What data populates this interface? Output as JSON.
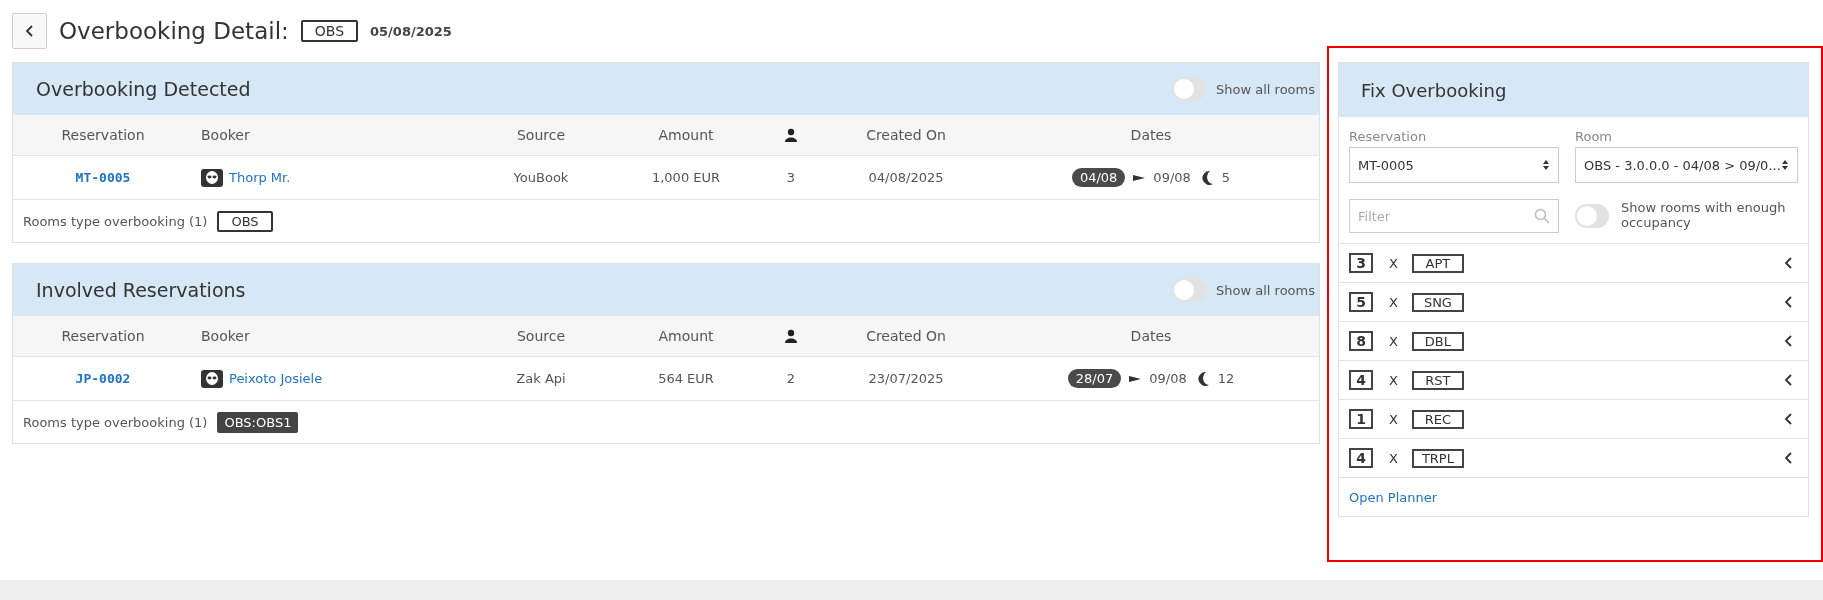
{
  "header": {
    "title": "Overbooking Detail:",
    "room_type": "OBS",
    "date": "05/08/2025"
  },
  "sections": [
    {
      "title": "Overbooking Detected",
      "toggle": {
        "label": "Show all rooms",
        "on": false
      },
      "columns": [
        {
          "kind": "text",
          "label": "Reservation"
        },
        {
          "kind": "text",
          "label": "Booker"
        },
        {
          "kind": "text",
          "label": "Source"
        },
        {
          "kind": "text",
          "label": "Amount"
        },
        {
          "kind": "guests"
        },
        {
          "kind": "text",
          "label": "Created On"
        },
        {
          "kind": "text",
          "label": "Dates"
        }
      ],
      "rows": [
        {
          "reservation": "MT-0005",
          "booker": "Thorp Mr.",
          "source": "YouBook",
          "amount": "1,000 EUR",
          "guests": "3",
          "created_on": "04/08/2025",
          "arrival": "04/08",
          "departure": "09/08",
          "nights": "5"
        }
      ],
      "footer": {
        "label": "Rooms type overbooking (1)",
        "room_types": [
          {
            "label": "OBS",
            "kind": "outline"
          }
        ]
      }
    },
    {
      "title": "Involved Reservations",
      "toggle": {
        "label": "Show all rooms",
        "on": false
      },
      "columns": [
        {
          "kind": "text",
          "label": "Reservation"
        },
        {
          "kind": "text",
          "label": "Booker"
        },
        {
          "kind": "text",
          "label": "Source"
        },
        {
          "kind": "text",
          "label": "Amount"
        },
        {
          "kind": "guests"
        },
        {
          "kind": "text",
          "label": "Created On"
        },
        {
          "kind": "text",
          "label": "Dates"
        }
      ],
      "rows": [
        {
          "reservation": "JP-0002",
          "booker": "Peixoto Josiele",
          "source": "Zak Api",
          "amount": "564 EUR",
          "guests": "2",
          "created_on": "23/07/2025",
          "arrival": "28/07",
          "departure": "09/08",
          "nights": "12"
        }
      ],
      "footer": {
        "label": "Rooms type overbooking (1)",
        "room_types": [
          {
            "label": "OBS:OBS1",
            "kind": "filled"
          }
        ]
      }
    }
  ],
  "fix_panel": {
    "title": "Fix Overbooking",
    "reservation": {
      "label": "Reservation",
      "value": "MT-0005"
    },
    "room": {
      "label": "Room",
      "value": "OBS - 3.0.0.0 - 04/08 > 09/0..."
    },
    "filter": {
      "placeholder": "Filter"
    },
    "toggle": {
      "label": "Show rooms with enough occupancy",
      "on": false
    },
    "room_types": [
      {
        "count": "3",
        "separator": "X",
        "code": "APT"
      },
      {
        "count": "5",
        "separator": "X",
        "code": "SNG"
      },
      {
        "count": "8",
        "separator": "X",
        "code": "DBL"
      },
      {
        "count": "4",
        "separator": "X",
        "code": "RST"
      },
      {
        "count": "1",
        "separator": "X",
        "code": "REC"
      },
      {
        "count": "4",
        "separator": "X",
        "code": "TRPL"
      }
    ],
    "link": "Open Planner"
  }
}
